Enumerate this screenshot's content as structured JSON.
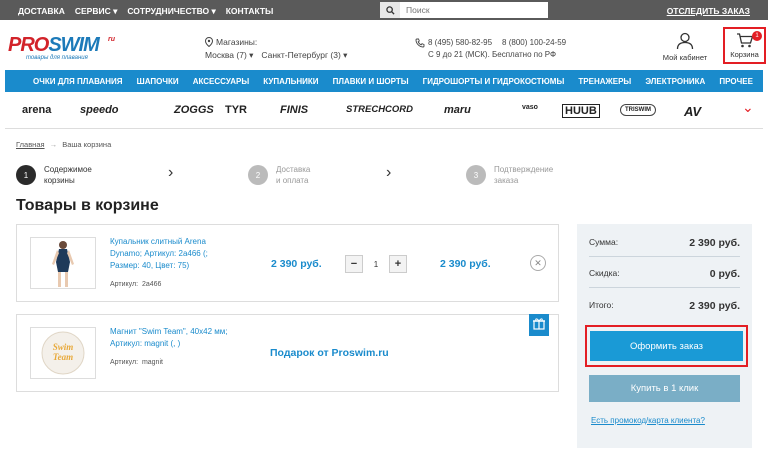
{
  "topbar": {
    "nav": [
      "ДОСТАВКА",
      "СЕРВИС ▾",
      "СОТРУДНИЧЕСТВО ▾",
      "КОНТАКТЫ"
    ],
    "search_placeholder": "Поиск",
    "track_order": "ОТСЛЕДИТЬ ЗАКАЗ"
  },
  "header": {
    "logo_main": "PRO",
    "logo_accent": "SWIM",
    "logo_ru": "ru",
    "logo_tagline": "товары для плавания",
    "stores_label": "Магазины:",
    "city_1": "Москва (7) ▾",
    "city_2": "Санкт-Петербург (3) ▾",
    "phone_1": "8 (495) 580-82-95",
    "phone_2": "8 (800) 100-24-59",
    "hours": "С 9 до 21 (МСК). Бесплатно по РФ",
    "cabinet_label": "Мой кабинет",
    "cart_label": "Корзина",
    "cart_count": "1"
  },
  "categories": [
    "ОЧКИ ДЛЯ ПЛАВАНИЯ",
    "ШАПОЧКИ",
    "АКСЕССУАРЫ",
    "КУПАЛЬНИКИ",
    "ПЛАВКИ И ШОРТЫ",
    "ГИДРОШОРТЫ И ГИДРОКОСТЮМЫ",
    "ТРЕНАЖЕРЫ",
    "ЭЛЕКТРОНИКА",
    "ПРОЧЕЕ"
  ],
  "brands": [
    "arena",
    "speedo",
    "ZOGGS",
    "TYR",
    "FINIS",
    "STRECHCORD",
    "maru",
    "vaso",
    "HUUB",
    "TRISWIM",
    "AV"
  ],
  "breadcrumb": {
    "home": "Главная",
    "sep": "→",
    "current": "Ваша корзина"
  },
  "steps": [
    {
      "num": "1",
      "line1": "Содержимое",
      "line2": "корзины",
      "color": "#2b2b2b"
    },
    {
      "num": "2",
      "line1": "Доставка",
      "line2": "и оплата",
      "color": "#bbbbbb"
    },
    {
      "num": "3",
      "line1": "Подтверждение",
      "line2": "заказа",
      "color": "#bbbbbb"
    }
  ],
  "page_title": "Товары в корзине",
  "items": [
    {
      "name_line1": "Купальник слитный Arena",
      "name_line2": "Dynamo; Артикул: 2a466 (;",
      "name_line3": "Размер: 40, Цвет: 75)",
      "sku_label": "Артикул:",
      "sku": "2a466",
      "price": "2 390 руб.",
      "quantity": "1",
      "total": "2 390 руб."
    },
    {
      "name_line1": "Магнит \"Swim Team\", 40x42 мм;",
      "name_line2": "Артикул: magnit (, )",
      "sku_label": "Артикул:",
      "sku": "magnit",
      "gift_label": "Подарок от Proswim.ru"
    }
  ],
  "summary": {
    "sum_label": "Сумма:",
    "sum_value": "2 390 руб.",
    "discount_label": "Скидка:",
    "discount_value": "0 руб.",
    "total_label": "Итого:",
    "total_value": "2 390 руб.",
    "order_button": "Оформить заказ",
    "one_click_button": "Купить в 1 клик",
    "promo_link": "Есть промокод/карта клиента?"
  },
  "colors": {
    "accent": "#1a8bcc",
    "highlight": "#e31e24",
    "topbar": "#5a5a5a"
  }
}
